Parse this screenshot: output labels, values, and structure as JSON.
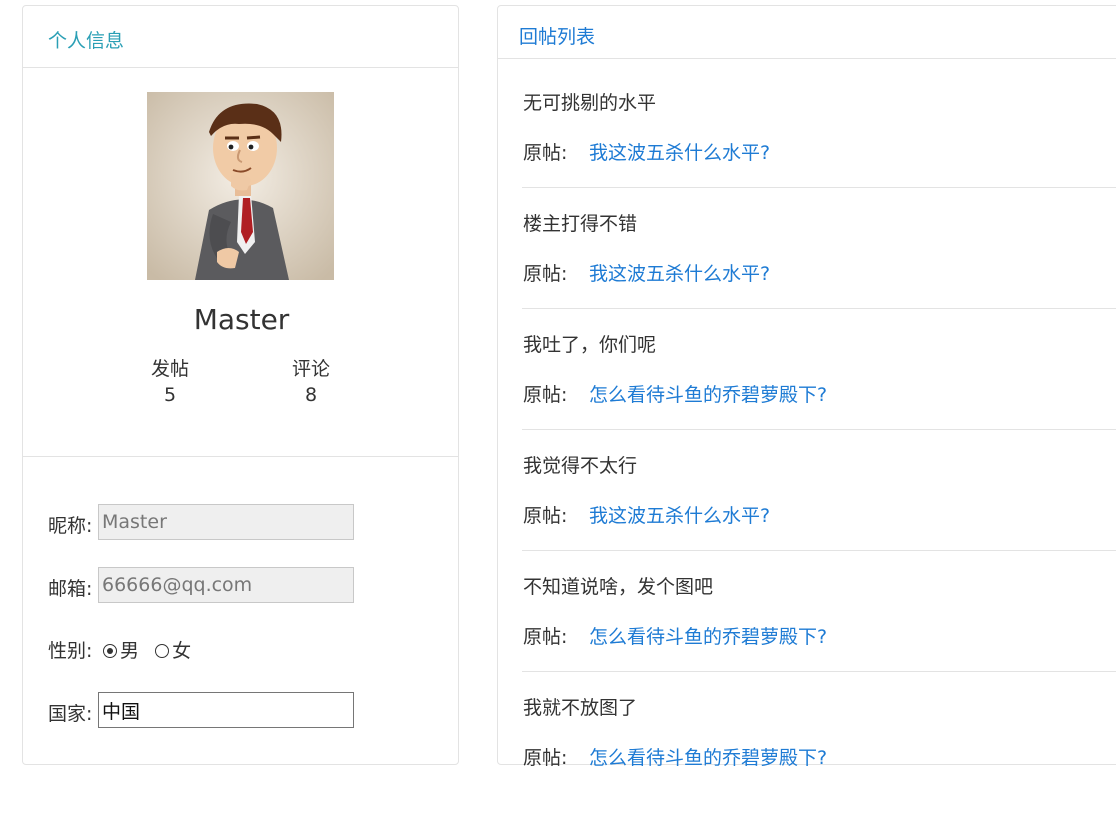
{
  "profile_panel": {
    "title": "个人信息",
    "username": "Master",
    "stats": [
      {
        "label": "发帖",
        "value": "5"
      },
      {
        "label": "评论",
        "value": "8"
      }
    ],
    "form": {
      "nickname_label": "昵称:",
      "nickname_value": "Master",
      "email_label": "邮箱:",
      "email_value": "66666@qq.com",
      "gender_label": "性别:",
      "gender_options": [
        "男",
        "女"
      ],
      "gender_selected": "男",
      "country_label": "国家:",
      "country_value": "中国"
    }
  },
  "replies_panel": {
    "title": "回帖列表",
    "origin_label": "原帖:",
    "items": [
      {
        "content": "无可挑剔的水平",
        "origin": "我这波五杀什么水平?"
      },
      {
        "content": "楼主打得不错",
        "origin": "我这波五杀什么水平?"
      },
      {
        "content": "我吐了，你们呢",
        "origin": "怎么看待斗鱼的乔碧萝殿下?"
      },
      {
        "content": "我觉得不太行",
        "origin": "我这波五杀什么水平?"
      },
      {
        "content": "不知道说啥，发个图吧",
        "origin": "怎么看待斗鱼的乔碧萝殿下?"
      },
      {
        "content": "我就不放图了",
        "origin": "怎么看待斗鱼的乔碧萝殿下?"
      }
    ]
  },
  "colors": {
    "profile_title": "#2a9fb5",
    "link": "#1e7bd4",
    "border": "#e3e3e3"
  }
}
